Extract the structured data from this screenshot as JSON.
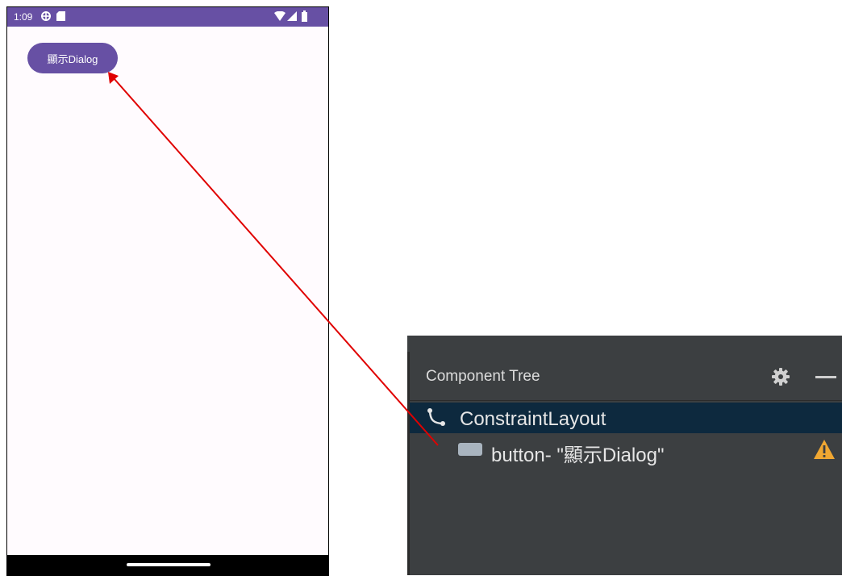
{
  "phone": {
    "status_bar": {
      "time": "1:09",
      "icons": [
        "gear-icon",
        "sd-card-icon",
        "wifi-icon",
        "signal-icon",
        "battery-icon"
      ]
    },
    "button_label": "顯示Dialog",
    "accent_color": "#6750a4"
  },
  "component_tree": {
    "title": "Component Tree",
    "header_icons": [
      "gear-icon",
      "minimize-icon"
    ],
    "items": [
      {
        "label": "ConstraintLayout",
        "icon": "constraint-layout-icon",
        "selected": true
      },
      {
        "type": "button",
        "label": "button- \"顯示Dialog\"",
        "icon": "button-icon",
        "warning": true
      }
    ],
    "selected_row_color": "#0d293e",
    "warning_color": "#f0a732"
  },
  "annotation": {
    "arrow_color": "#e00000"
  }
}
